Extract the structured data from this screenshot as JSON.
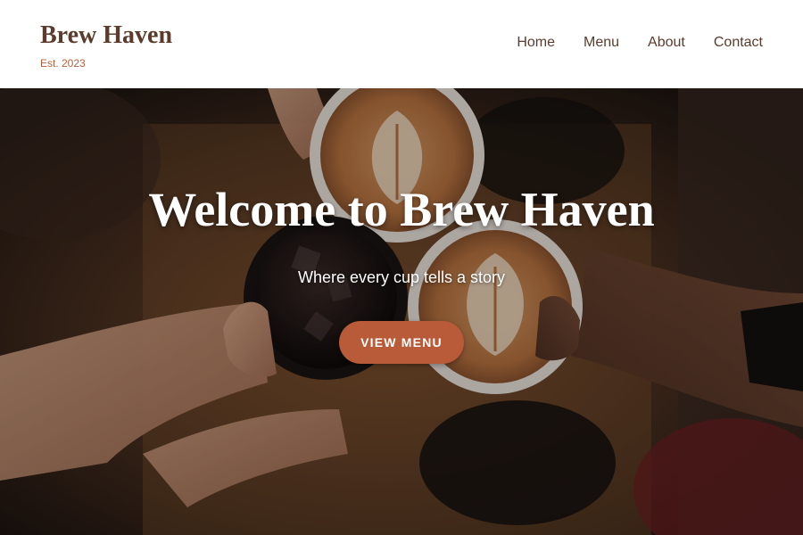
{
  "header": {
    "brand_name": "Brew Haven",
    "brand_tagline": "Est. 2023",
    "nav": [
      "Home",
      "Menu",
      "About",
      "Contact"
    ]
  },
  "hero": {
    "title": "Welcome to Brew Haven",
    "subtitle": "Where every cup tells a story",
    "cta_label": "VIEW MENU"
  },
  "colors": {
    "brand_brown": "#5a3b2c",
    "accent_terracotta": "#b95a38",
    "header_bg": "#ffffff"
  }
}
